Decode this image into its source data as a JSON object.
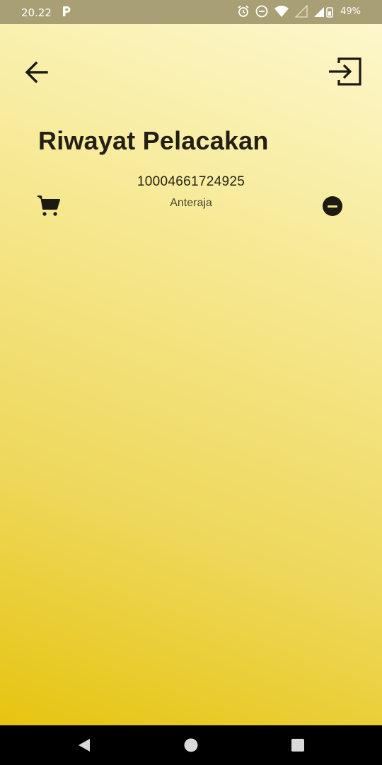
{
  "status_bar": {
    "time": "20.22",
    "battery": "49%",
    "icons": [
      "parking-app-icon",
      "alarm-icon",
      "do-not-disturb-icon",
      "wifi-icon",
      "signal-icon",
      "battery-icon"
    ]
  },
  "header": {
    "back_icon": "arrow-left-icon",
    "exit_icon": "login-exit-icon"
  },
  "page": {
    "title": "Riwayat Pelacakan"
  },
  "history": [
    {
      "tracking_number": "10004661724925",
      "courier": "Anteraja",
      "icon": "cart-icon",
      "action_icon": "remove-circle-icon"
    }
  ],
  "colors": {
    "gradient_top": "#fdf7cc",
    "gradient_bottom": "#e6c410",
    "text_dark": "#231f14",
    "status_bar": "#a89f74"
  },
  "nav_bar": {
    "buttons": [
      "nav-back-icon",
      "nav-home-icon",
      "nav-recents-icon"
    ]
  }
}
